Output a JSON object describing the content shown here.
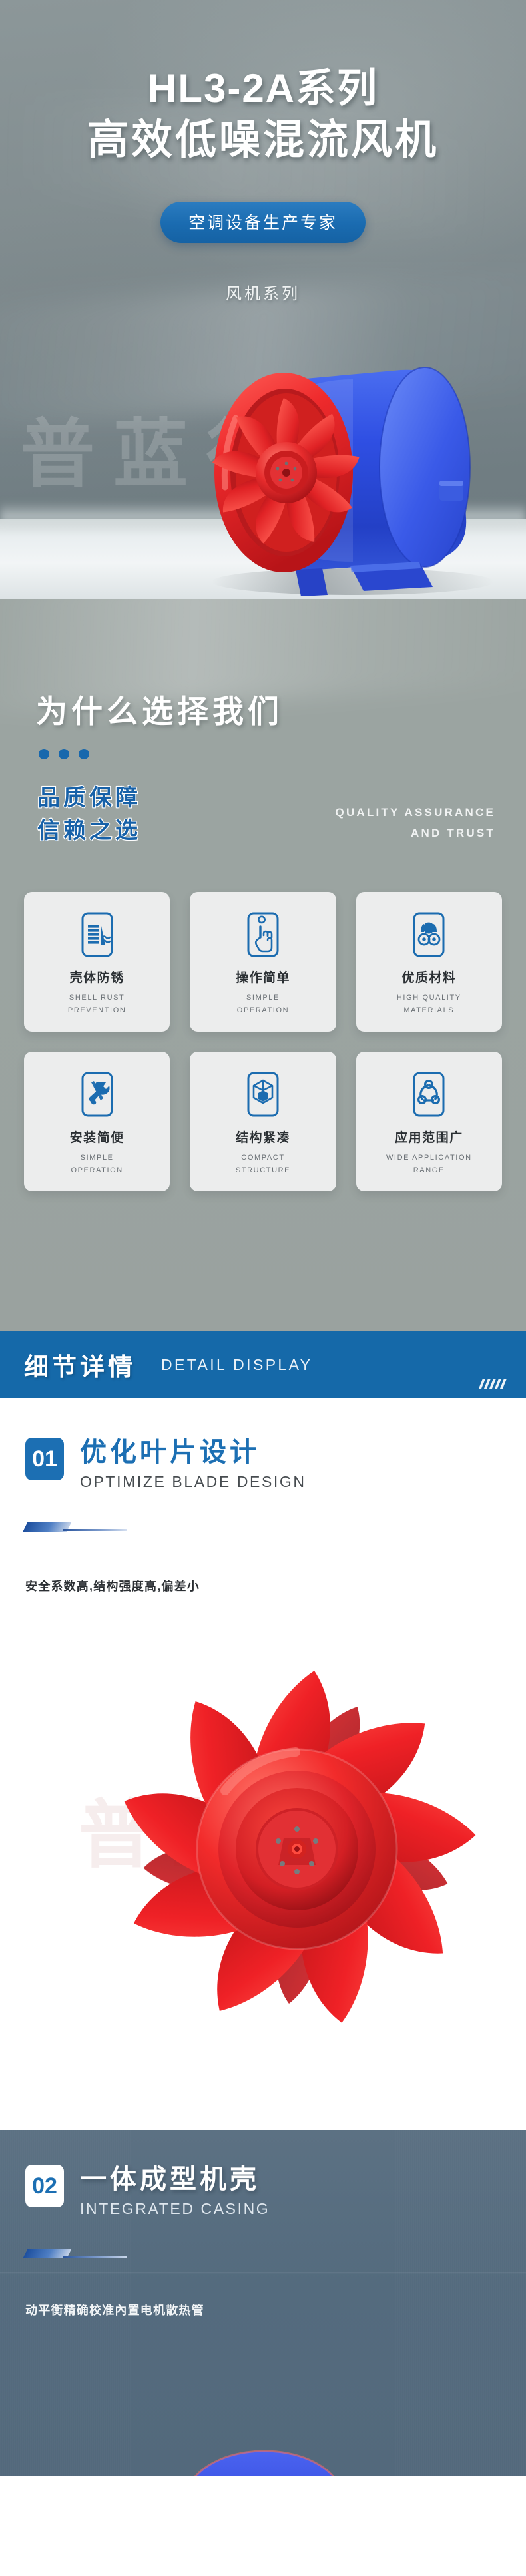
{
  "hero": {
    "title_line1": "HL3-2A系列",
    "title_line2": "高效低噪混流风机",
    "badge": "空调设备生产专家",
    "subtitle": "风机系列",
    "watermark": "普蓝得"
  },
  "why": {
    "heading": "为什么选择我们",
    "slogan_line1": "品质保障",
    "slogan_line2": "信赖之选",
    "slogan_en_line1": "QUALITY ASSURANCE",
    "slogan_en_line2": "AND TRUST",
    "cards": [
      {
        "icon": "rust-prevention-icon",
        "cn": "壳体防锈",
        "en": "SHELL RUST PREVENTION"
      },
      {
        "icon": "touch-hand-icon",
        "cn": "操作简单",
        "en": "SIMPLE OPERATION"
      },
      {
        "icon": "steel-coils-icon",
        "cn": "优质材料",
        "en": "HIGH QUALITY MATERIALS"
      },
      {
        "icon": "wrench-screwdriver-icon",
        "cn": "安装简便",
        "en": "SIMPLE OPERATION"
      },
      {
        "icon": "cube-structure-icon",
        "cn": "结构紧凑",
        "en": "COMPACT STRUCTURE"
      },
      {
        "icon": "network-nodes-icon",
        "cn": "应用范围广",
        "en": "WIDE APPLICATION RANGE"
      }
    ]
  },
  "banner": {
    "cn": "细节详情",
    "en": "DETAIL DISPLAY"
  },
  "sections": [
    {
      "number": "01",
      "cn": "优化叶片设计",
      "en": "OPTIMIZE BLADE DESIGN",
      "desc": "安全系数高,结构强度高,偏差小",
      "watermark": "普蓝得"
    },
    {
      "number": "02",
      "cn": "一体成型机壳",
      "en": "INTEGRATED CASING",
      "desc": "动平衡精确校准內置电机散热管"
    }
  ],
  "colors": {
    "brand_blue": "#1569a9",
    "deep_blue": "#1c6fb3",
    "fan_red": "#e8252a",
    "fan_blue": "#2d4fe0",
    "slate": "#546b7e",
    "gray_green": "#9ba4a1"
  }
}
